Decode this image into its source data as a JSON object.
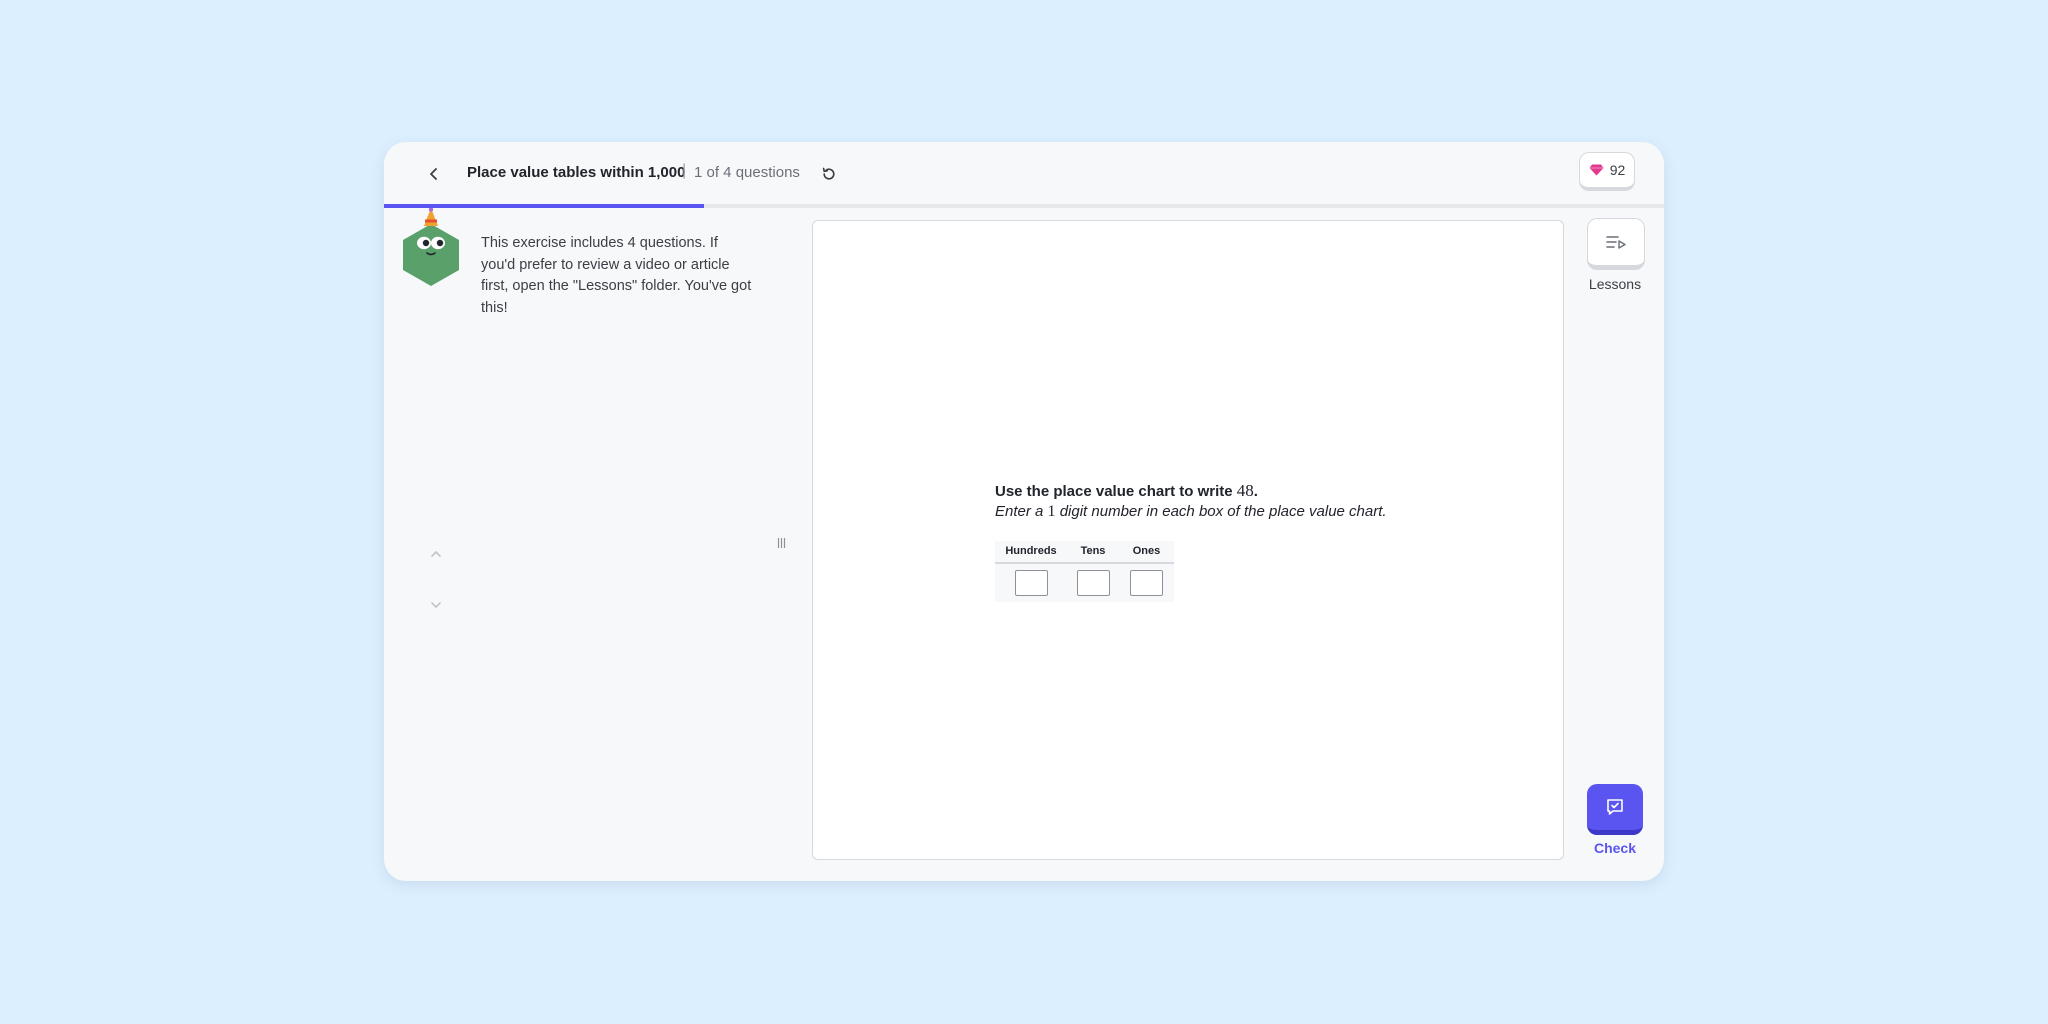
{
  "header": {
    "title": "Place value tables within 1,000",
    "separator": "|",
    "progress_text": "1 of 4 questions",
    "gems": "92"
  },
  "progress": {
    "fraction": 0.25,
    "color": "#5a55f0"
  },
  "sidebar": {
    "intro": "This exercise includes 4 questions. If you'd prefer to review a video or article first, open the \"Lessons\" folder. You've got this!"
  },
  "question": {
    "title_prefix": "Use the place value chart to write ",
    "title_number": "48",
    "title_suffix": ".",
    "sub_prefix": "Enter a ",
    "sub_number": "1",
    "sub_suffix": " digit number in each box of the place value chart.",
    "table": {
      "headers": [
        "Hundreds",
        "Tens",
        "Ones"
      ],
      "values": [
        "",
        "",
        ""
      ]
    }
  },
  "rail": {
    "lessons_label": "Lessons",
    "check_label": "Check"
  },
  "colors": {
    "accent": "#5a55f0",
    "background": "#dcefff",
    "gem": "#e0398e",
    "avatar": "#5aa06a"
  },
  "icons": {
    "back": "chevron-left-icon",
    "restart": "restart-icon",
    "gem": "gem-icon",
    "lessons": "playlist-icon",
    "check": "check-icon",
    "nav_up": "chevron-up-icon",
    "nav_down": "chevron-down-icon"
  }
}
